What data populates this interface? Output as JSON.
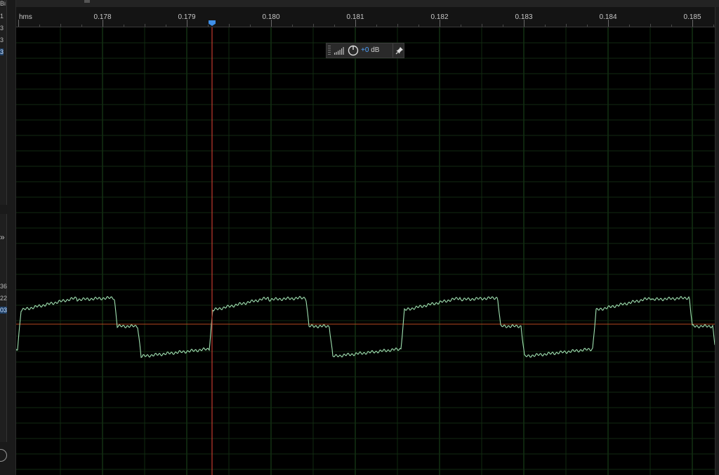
{
  "ruler": {
    "unit": "hms",
    "ticks": [
      "0.178",
      "0.179",
      "0.180",
      "0.181",
      "0.182",
      "0.183",
      "0.184",
      "0.185"
    ]
  },
  "hud": {
    "gain_value": "+0",
    "gain_unit": "dB",
    "icons": [
      "grip-icon",
      "level-meter-icon",
      "gain-knob-icon",
      "pin-icon"
    ]
  },
  "left_panel": {
    "top_labels": [
      "Bi",
      "1",
      "3",
      "3",
      "3"
    ],
    "selected_top_index": 4,
    "bottom_labels": [
      "36",
      "22",
      "03"
    ],
    "selected_bottom_index": 2
  },
  "icons": {
    "expand": "»",
    "playhead": "playhead-marker-icon"
  },
  "colors": {
    "background": "#000000",
    "waveform": "#9fe0b0",
    "grid": "#1b4a1b",
    "playhead": "#c23a2f",
    "center_line": "#b5481e",
    "selection": "#4fa3ff"
  }
}
